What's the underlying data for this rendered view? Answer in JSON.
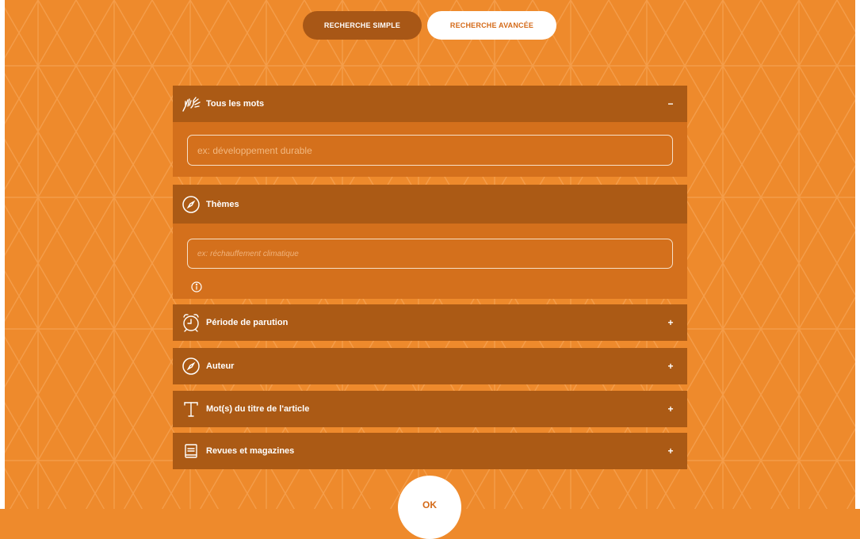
{
  "modes": {
    "simple_label": "RECHERCHE SIMPLE",
    "advanced_label": "RECHERCHE AVANCÉE"
  },
  "colors": {
    "background": "#ee8a2c",
    "header": "#ab5a15",
    "body": "#d4701c",
    "white": "#ffffff"
  },
  "sections": {
    "all_words": {
      "title": "Tous les mots",
      "toggle": "−",
      "expanded": true,
      "icon": "hands-icon",
      "placeholder": "ex: développement durable",
      "value": ""
    },
    "themes": {
      "title": "Thèmes",
      "expanded": true,
      "icon": "compass-icon",
      "placeholder": "ex: réchauffement climatique",
      "value": "",
      "info_icon": "info-icon"
    },
    "period": {
      "title": "Période de parution",
      "toggle": "+",
      "expanded": false,
      "icon": "alarm-clock-icon"
    },
    "author": {
      "title": "Auteur",
      "toggle": "+",
      "expanded": false,
      "icon": "compass-icon"
    },
    "article_title": {
      "title": "Mot(s) du titre de l'article",
      "toggle": "+",
      "expanded": false,
      "icon": "text-t-icon"
    },
    "journals": {
      "title": "Revues et magazines",
      "toggle": "+",
      "expanded": false,
      "icon": "book-icon"
    }
  },
  "submit": {
    "label": "OK"
  }
}
